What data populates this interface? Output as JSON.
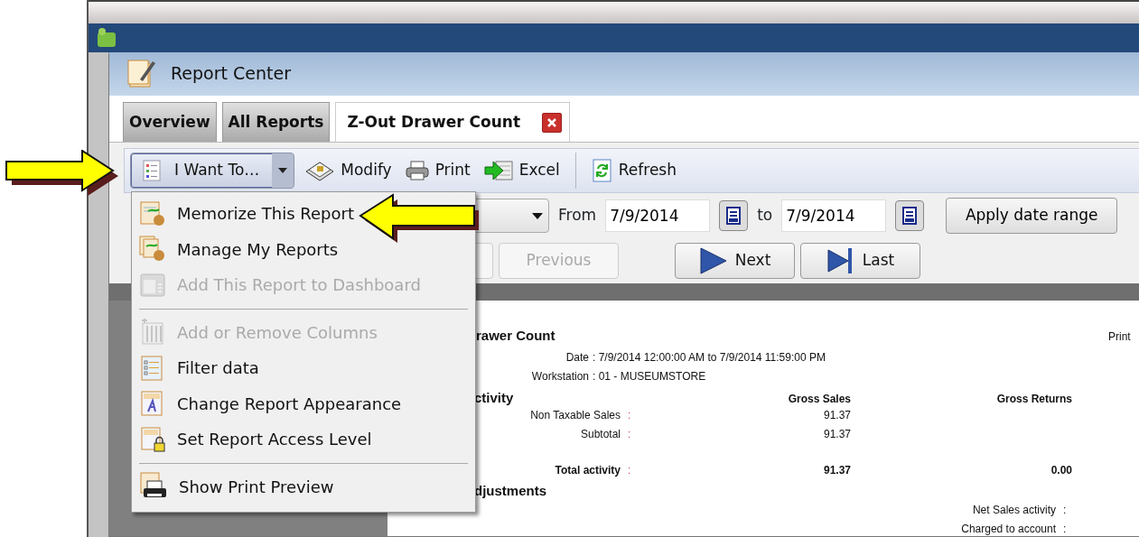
{
  "window": {
    "title": "Report Center"
  },
  "tabs": [
    {
      "label": "Overview",
      "selected": false,
      "closable": false
    },
    {
      "label": "All Reports",
      "selected": false,
      "closable": false
    },
    {
      "label": "Z-Out Drawer Count",
      "selected": true,
      "closable": true
    }
  ],
  "toolbar": [
    {
      "kind": "menu",
      "label": "I Want To…",
      "expanded": true
    },
    {
      "kind": "button",
      "label": "Modify"
    },
    {
      "kind": "button",
      "label": "Print"
    },
    {
      "kind": "button",
      "label": "Excel"
    },
    {
      "kind": "separator"
    },
    {
      "kind": "button",
      "label": "Refresh"
    }
  ],
  "menu": {
    "groups": [
      [
        {
          "label": "Memorize This Report",
          "disabled": false
        },
        {
          "label": "Manage My Reports",
          "disabled": false
        },
        {
          "label": "Add This Report to Dashboard",
          "disabled": true
        }
      ],
      [
        {
          "label": "Add or Remove Columns",
          "disabled": true
        },
        {
          "label": "Filter data",
          "disabled": false
        },
        {
          "label": "Change Report Appearance",
          "disabled": false
        },
        {
          "label": "Set Report Access Level",
          "disabled": false
        }
      ],
      [
        {
          "label": "Show Print Preview",
          "disabled": false
        }
      ]
    ]
  },
  "date_filter": {
    "from_label": "From",
    "from": "7/9/2014",
    "to_label": "to",
    "to": "7/9/2014",
    "apply": "Apply date range"
  },
  "navigation": [
    {
      "disabled": true
    },
    {
      "label": "Previous",
      "disabled": true
    },
    {
      "label": "Next",
      "disabled": false
    },
    {
      "label": "Last",
      "disabled": false
    }
  ],
  "report": {
    "title": "rawer Count",
    "corner": "Print",
    "info": [
      {
        "label": "Date",
        "value": ": 7/9/2014 12:00:00 AM to 7/9/2014 11:59:00 PM"
      },
      {
        "label": "Workstation",
        "value": ": 01 - MUSEUMSTORE"
      }
    ],
    "rows": [
      {
        "kind": "section",
        "label": "ctivity",
        "col_1": "Gross Sales",
        "col_2": "Gross Returns"
      },
      {
        "kind": "line",
        "label": "Non Taxable Sales",
        "sep": ":",
        "col_1": "91.37"
      },
      {
        "kind": "line",
        "label": "Subtotal",
        "sep": ":",
        "col_1": "91.37"
      },
      {
        "kind": "total",
        "label": "Total activity",
        "sep": ":",
        "col_1": "91.37",
        "col_2": "0.00"
      },
      {
        "kind": "section",
        "label": "djustments"
      },
      {
        "kind": "summary",
        "label": "Net Sales activity",
        "sep": ":"
      },
      {
        "kind": "summary",
        "label": "Charged to account",
        "sep": ":"
      }
    ]
  }
}
